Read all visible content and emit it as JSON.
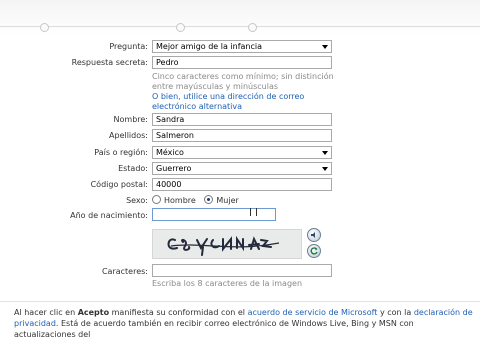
{
  "form": {
    "question": {
      "label": "Pregunta:",
      "value": "Mejor amigo de la infancia"
    },
    "secret_answer": {
      "label": "Respuesta secreta:",
      "value": "Pedro"
    },
    "secret_hint": {
      "line1": "Cinco caracteres como mínimo; sin distinción",
      "line2": "entre mayúsculas y minúsculas",
      "link_line1": "O bien, utilice una dirección de correo",
      "link_line2": "electrónico alternativa"
    },
    "first_name": {
      "label": "Nombre:",
      "value": "Sandra"
    },
    "last_name": {
      "label": "Apellidos:",
      "value": "Salmeron"
    },
    "country": {
      "label": "País o región:",
      "value": "México"
    },
    "state": {
      "label": "Estado:",
      "value": "Guerrero"
    },
    "postal_code": {
      "label": "Código postal:",
      "value": "40000"
    },
    "gender": {
      "label": "Sexo:",
      "options": [
        "Hombre",
        "Mujer"
      ],
      "selected": "Mujer"
    },
    "birth_year": {
      "label": "Año de nacimiento:",
      "value": ""
    },
    "captcha": {
      "image_text": "CSYCRNNA"
    },
    "characters": {
      "label": "Caracteres:",
      "value": "",
      "hint": "Escriba los 8 caracteres de la imagen"
    }
  },
  "footer": {
    "p1": "Al hacer clic en ",
    "accept": "Acepto",
    "p2": " manifiesta su conformidad con el ",
    "link1": "acuerdo de servicio de Microsoft",
    "p3": " y con la ",
    "link2": "declaración de privacidad",
    "p4": ".  Está de acuerdo también en recibir correo electrónico de Windows Live, Bing y MSN con actualizaciones del"
  },
  "colors": {
    "link": "#1e5fb4",
    "hint": "#8a8a8a",
    "radio_selected": "#1c3c7a"
  },
  "icons": {
    "captcha_audio": "audio-speaker-icon",
    "captcha_refresh": "refresh-icon"
  }
}
